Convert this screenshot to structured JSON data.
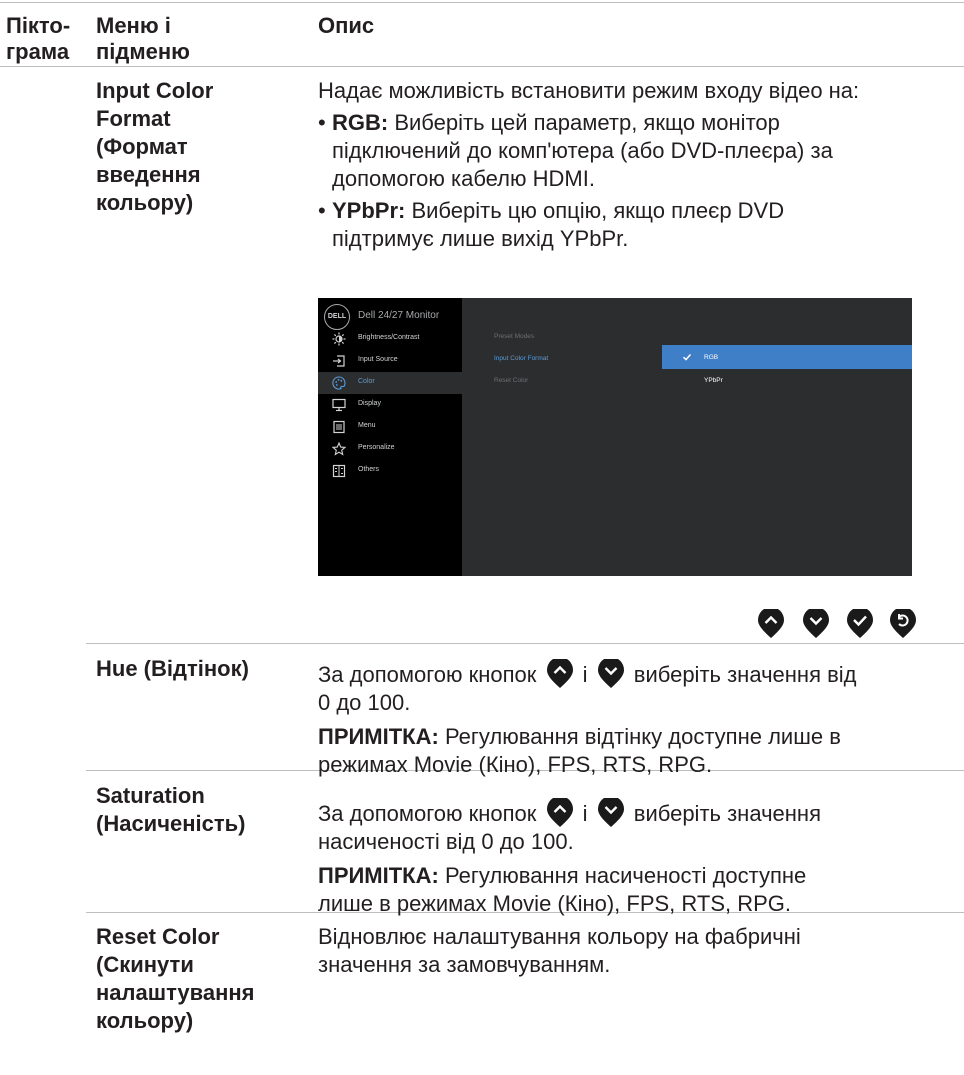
{
  "header": {
    "col1": [
      "Пікто-",
      "грама"
    ],
    "col2": [
      "Меню і",
      "підменю"
    ],
    "col3": "Опис"
  },
  "input_color": {
    "name": [
      "Input Color",
      "Format",
      "(Формат",
      "введення",
      "кольору)"
    ],
    "intro": "Надає можливість встановити режим входу відео на:",
    "rgb_label": "RGB:",
    "rgb_text_1": " Виберіть цей параметр, якщо монітор",
    "rgb_text_2": "підключений до комп'ютера (або DVD-плеєра) за",
    "rgb_text_3": "допомогою кабелю HDMI.",
    "ypbpr_label": "YPbPr:",
    "ypbpr_text_1": " Виберіть цю опцію, якщо плеєр DVD",
    "ypbpr_text_2": "підтримує лише вихід YPbPr."
  },
  "osd": {
    "logo": "DELL",
    "title": "Dell 24/27 Monitor",
    "menu": [
      {
        "label": "Brightness/Contrast",
        "icon": "brightness-icon"
      },
      {
        "label": "Input Source",
        "icon": "input-source-icon"
      },
      {
        "label": "Color",
        "icon": "color-palette-icon"
      },
      {
        "label": "Display",
        "icon": "display-icon"
      },
      {
        "label": "Menu",
        "icon": "menu-icon"
      },
      {
        "label": "Personalize",
        "icon": "star-icon"
      },
      {
        "label": "Others",
        "icon": "others-icon"
      }
    ],
    "submenu": [
      "Preset Modes",
      "Input Color Format",
      "Reset Color"
    ],
    "options": [
      "RGB",
      "YPbPr"
    ],
    "accent": "#3f7fc8"
  },
  "hue": {
    "name": "Hue (Відтінок)",
    "line1_a": "За допомогою кнопок ",
    "line1_mid": " і ",
    "line1_b": " виберіть значення від",
    "line2": "0 до 100.",
    "note_label": "ПРИМІТКА:",
    "note_1": " Регулювання відтінку доступне лише в",
    "note_2": "режимах Movie (Кіно), FPS, RTS, RPG."
  },
  "saturation": {
    "name": [
      "Saturation",
      "(Насиченість)"
    ],
    "line1_a": "За допомогою кнопок ",
    "line1_mid": " і ",
    "line1_b": " виберіть значення",
    "line2": "насиченості від 0 до 100.",
    "note_label": "ПРИМІТКА:",
    "note_1": " Регулювання насиченості доступне",
    "note_2": "лише в режимах Movie (Кіно), FPS, RTS, RPG."
  },
  "reset": {
    "name": [
      "Reset Color",
      "(Скинути",
      "налаштування",
      "кольору)"
    ],
    "text_1": "Відновлює налаштування кольору на фабричні",
    "text_2": "значення за замовчуванням."
  },
  "buttons": [
    "up-button-icon",
    "down-button-icon",
    "ok-button-icon",
    "back-button-icon"
  ]
}
